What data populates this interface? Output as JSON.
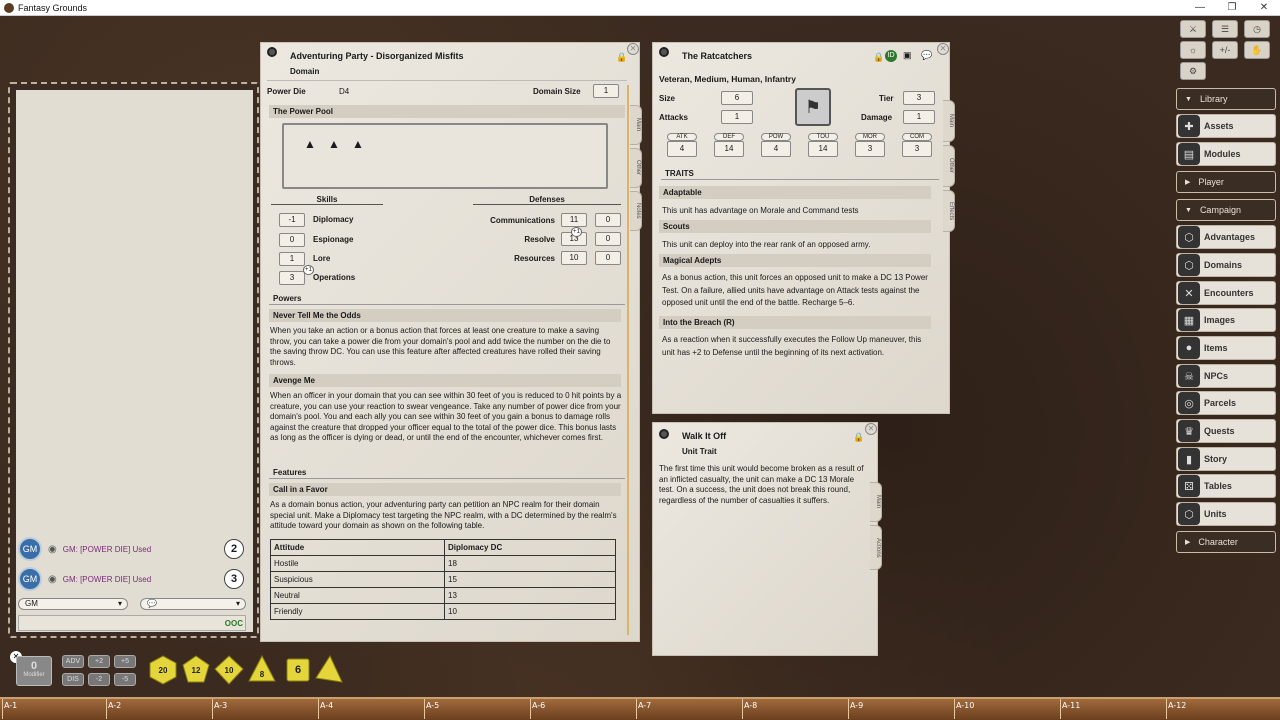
{
  "app": {
    "title": "Fantasy Grounds",
    "min": "—",
    "max": "❐",
    "close": "✕"
  },
  "chat": {
    "messages": [
      {
        "avatar": "GM",
        "text": "GM:  [POWER DIE] Used",
        "count": "2"
      },
      {
        "avatar": "GM",
        "text": "GM:  [POWER DIE] Used",
        "count": "3"
      }
    ],
    "identity": "GM",
    "mode": "",
    "ooc": "OOC"
  },
  "party": {
    "title": "Adventuring Party - Disorganized Misfits",
    "subtitle": "Domain",
    "power_die_label": "Power Die",
    "power_die": "D4",
    "domain_size_label": "Domain Size",
    "domain_size": "1",
    "power_pool_label": "The Power Pool",
    "skills_label": "Skills",
    "defenses_label": "Defenses",
    "skills": [
      {
        "v": "-1",
        "n": "Diplomacy"
      },
      {
        "v": "0",
        "n": "Espionage"
      },
      {
        "v": "1",
        "n": "Lore"
      },
      {
        "v": "3",
        "n": "Operations"
      }
    ],
    "skill_bonus": "+1",
    "defenses": [
      {
        "n": "Communications",
        "v": "11",
        "m": "0"
      },
      {
        "n": "Resolve",
        "v": "13",
        "m": "0"
      },
      {
        "n": "Resources",
        "v": "10",
        "m": "0"
      }
    ],
    "def_bonus": "+1",
    "powers_label": "Powers",
    "power1_title": "Never Tell Me the Odds",
    "power1_text": "When you take an action or a bonus action that forces at least one creature to make a saving throw, you can take a power die from your domain's pool and add twice the number on the die to the saving throw DC. You can use this feature after affected creatures have rolled their saving throws.",
    "power2_title": "Avenge Me",
    "power2_text": "When an officer in your domain that you can see within 30 feet of you is reduced to 0 hit points by a creature, you can use your reaction to swear vengeance. Take any number of power dice from your domain's pool. You and each ally you can see within 30 feet of you gain a bonus to damage rolls against the creature that dropped your officer equal to the total of the power dice. This bonus lasts as long as the officer is dying or dead, or until the end of the encounter, whichever comes first.",
    "features_label": "Features",
    "feature1_title": "Call in a Favor",
    "feature1_text": "As a domain bonus action, your adventuring party can petition an NPC realm for their domain special unit. Make a Diplomacy test targeting the NPC realm, with a DC determined by the realm's attitude toward your domain as shown on the following table.",
    "table_headers": [
      "Attitude",
      "Diplomacy DC"
    ],
    "table_rows": [
      [
        "Hostile",
        "18"
      ],
      [
        "Suspicious",
        "15"
      ],
      [
        "Neutral",
        "13"
      ],
      [
        "Friendly",
        "10"
      ]
    ],
    "tabs": [
      "Main",
      "Other",
      "Notes"
    ]
  },
  "unit": {
    "title": "The Ratcatchers",
    "subtitle": "Veteran, Medium, Human, Infantry",
    "size_label": "Size",
    "size": "6",
    "tier_label": "Tier",
    "tier": "3",
    "attacks_label": "Attacks",
    "attacks": "1",
    "damage_label": "Damage",
    "damage": "1",
    "stats": [
      {
        "n": "ATK",
        "v": "4"
      },
      {
        "n": "DEF",
        "v": "14"
      },
      {
        "n": "POW",
        "v": "4"
      },
      {
        "n": "TOU",
        "v": "14"
      },
      {
        "n": "MOR",
        "v": "3"
      },
      {
        "n": "COM",
        "v": "3"
      }
    ],
    "traits_label": "TRAITS",
    "traits": [
      {
        "t": "Adaptable",
        "d": "This unit has advantage on Morale and Command tests"
      },
      {
        "t": "Scouts",
        "d": "This unit can deploy into the rear rank of an opposed army."
      },
      {
        "t": "Magical Adepts",
        "d": "As a bonus action, this unit forces an opposed unit to make a DC 13 Power Test. On a failure, allied units have advantage on Attack tests against the opposed unit until the end of the battle. Recharge 5–6."
      },
      {
        "t": "Into the Breach (R)",
        "d": "As a reaction when it successfully executes the Follow Up maneuver, this unit has +2 to Defense until the beginning of its next activation."
      }
    ],
    "tabs": [
      "Main",
      "Other",
      "Effects"
    ]
  },
  "trait": {
    "title": "Walk It Off",
    "subtitle": "Unit Trait",
    "text": "The first time this unit would become broken as a result of an inflicted casualty, the unit can make a DC 13 Morale test. On a success, the unit does not break this round, regardless of the number of casualties it suffers.",
    "tabs": [
      "Main",
      "Actions"
    ]
  },
  "sidebar": {
    "library": "Library",
    "player": "Player",
    "campaign": "Campaign",
    "character": "Character",
    "library_items": [
      "Assets",
      "Modules"
    ],
    "campaign_items": [
      "Advantages",
      "Domains",
      "Encounters",
      "Images",
      "Items",
      "NPCs",
      "Parcels",
      "Quests",
      "Story",
      "Tables",
      "Units"
    ],
    "tools": [
      "+/-"
    ]
  },
  "dice": {
    "modifier_value": "0",
    "modifier_label": "Modifier",
    "mods": [
      "ADV",
      "+2",
      "+5",
      "DIS",
      "-2",
      "-5"
    ],
    "dice": [
      "20",
      "12",
      "10",
      "8",
      "6",
      ""
    ]
  },
  "ruler": [
    "A-1",
    "A-2",
    "A-3",
    "A-4",
    "A-5",
    "A-6",
    "A-7",
    "A-8",
    "A-9",
    "A-10",
    "A-11",
    "A-12"
  ],
  "colors": {
    "leather": "#3b2a1f",
    "parchment": "#e6e1d8",
    "die": "#e4d63a",
    "gm_text": "#7a2a7a"
  }
}
